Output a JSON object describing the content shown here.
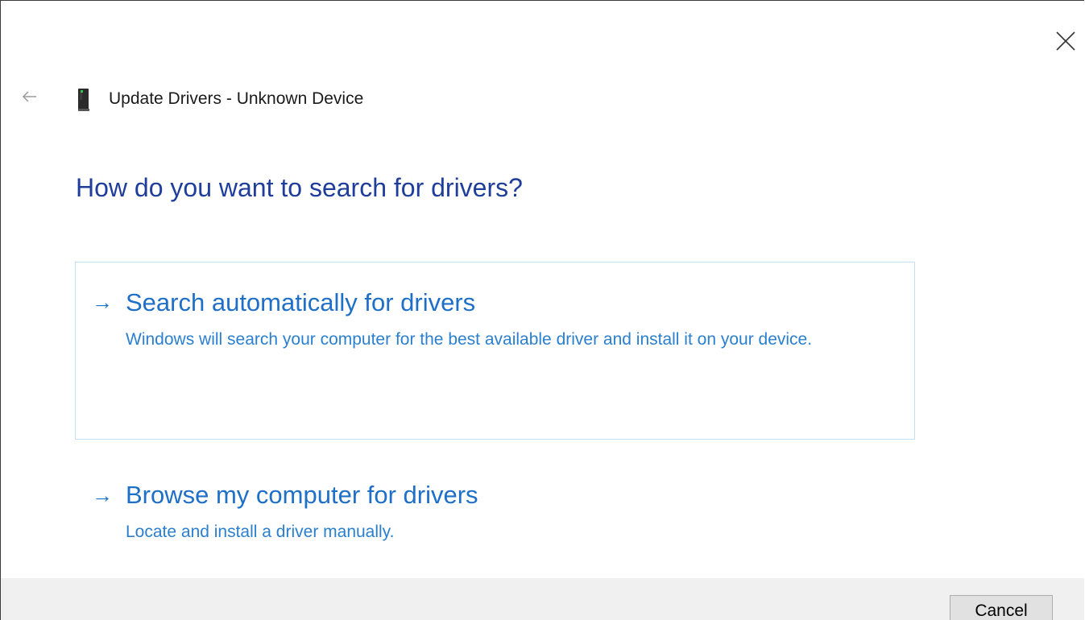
{
  "window": {
    "title": "Update Drivers - Unknown Device",
    "close_icon": "close-icon",
    "back_icon": "back-arrow-icon",
    "device_icon": "device-icon"
  },
  "heading": "How do you want to search for drivers?",
  "options": [
    {
      "arrow": "→",
      "title": "Search automatically for drivers",
      "description": "Windows will search your computer for the best available driver and install it on your device."
    },
    {
      "arrow": "→",
      "title": "Browse my computer for drivers",
      "description": "Locate and install a driver manually."
    }
  ],
  "footer": {
    "cancel_label": "Cancel"
  },
  "colors": {
    "heading": "#1f3d9b",
    "link": "#1e6fc8",
    "option_border": "#c5def3",
    "footer_bg": "#f0f0f0"
  }
}
